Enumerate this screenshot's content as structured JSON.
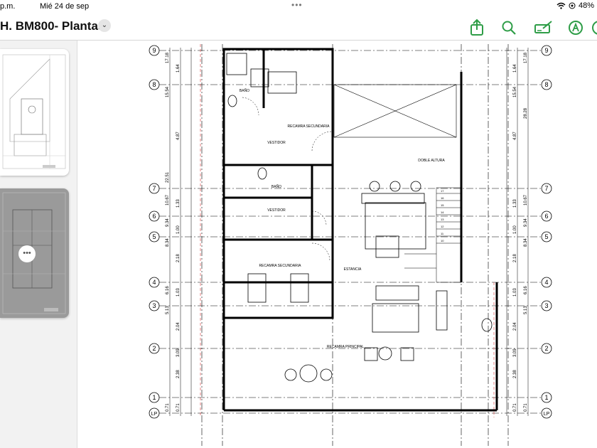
{
  "status_bar": {
    "time": "p.m.",
    "date": "Mié 24 de sep",
    "battery": "48%"
  },
  "toolbar": {
    "title": "H. BM800- Plantas",
    "icons": [
      "share-icon",
      "search-icon",
      "markup-icon",
      "pen-icon",
      "more-icon"
    ]
  },
  "sidebar": {
    "pages": [
      {
        "label": "page-1",
        "selected": false
      },
      {
        "label": "page-2",
        "selected": true
      }
    ],
    "more_button": "•••"
  },
  "plan": {
    "axes": [
      "9",
      "8",
      "7",
      "6",
      "5",
      "4",
      "3",
      "2",
      "1",
      "LP"
    ],
    "dims_left": [
      "17.18",
      "1.64",
      "15.54",
      "4.87",
      "22.51",
      "10.67",
      "1.33",
      "9.34",
      "1.00",
      "8.34",
      "2.18",
      "6.16",
      "1.03",
      "5.13",
      "2.04",
      "3.09",
      "2.38",
      "0.71",
      "0.71"
    ],
    "dims_right": [
      "17.18",
      "1.64",
      "15.54",
      "4.87",
      "28.28",
      "10.67",
      "1.33",
      "9.34",
      "1.00",
      "8.34",
      "2.18",
      "6.16",
      "1.03",
      "5.13",
      "2.04",
      "3.09",
      "2.38",
      "0.71",
      "0.71"
    ],
    "rooms": {
      "bano1": "BAÑO",
      "recamara_sec1": "RECAMRA SECUNDARIA",
      "vestidor1": "VESTIDOR",
      "doble_altura": "DOBLE ALTURA",
      "bano2": "BAÑO",
      "vestidor2": "VESTIDOR",
      "recamara_sec2": "RECAMRA SECUNDARIA",
      "estancia": "ESTANCIA",
      "recamara_principal": "RECAMRA PRINCIPAL"
    },
    "stair_numbers": [
      "17",
      "16",
      "15",
      "14",
      "13",
      "12",
      "11",
      "10"
    ]
  }
}
